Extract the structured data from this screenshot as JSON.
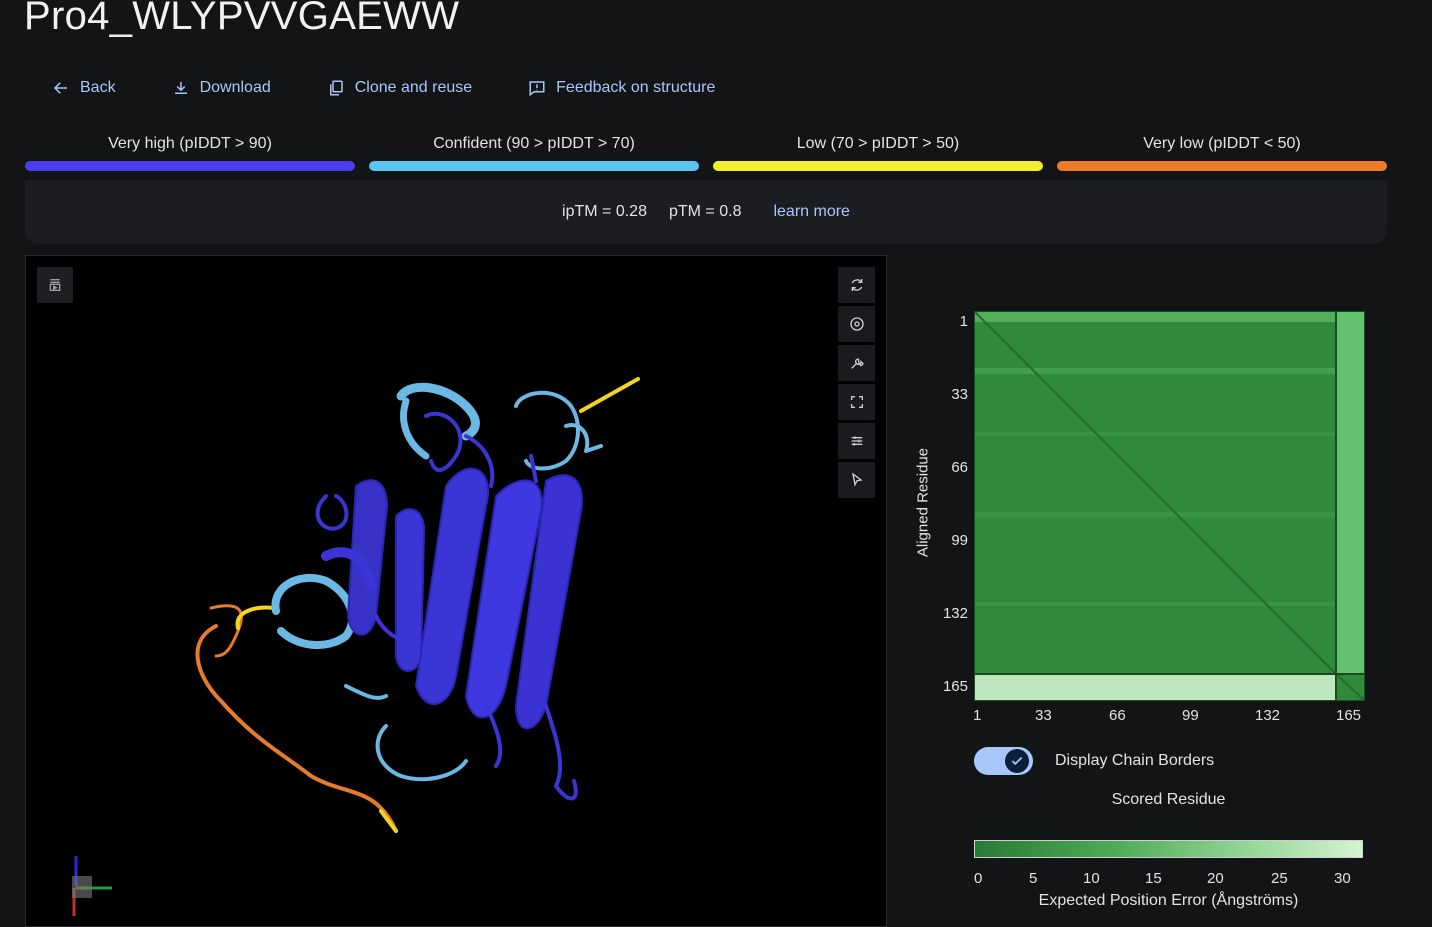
{
  "title": "Pro4_WLYPVVGAEWW",
  "toolbar": {
    "back": "Back",
    "download": "Download",
    "clone": "Clone and reuse",
    "feedback": "Feedback on structure"
  },
  "legend": [
    {
      "label": "Very high (pIDDT > 90)",
      "color": "#4b3ef0"
    },
    {
      "label": "Confident (90 > pIDDT > 70)",
      "color": "#5ac4f0"
    },
    {
      "label": "Low (70 > pIDDT > 50)",
      "color": "#f2f02a"
    },
    {
      "label": "Very low (pIDDT < 50)",
      "color": "#ec7c2a"
    }
  ],
  "metrics": {
    "iptm": "ipTM = 0.28",
    "ptm": "pTM = 0.8",
    "learn_more": "learn more"
  },
  "viewer_tools": [
    "restore-icon",
    "refresh-icon",
    "camera-icon",
    "wrench-icon",
    "fullscreen-icon",
    "sliders-icon",
    "cursor-icon"
  ],
  "pae": {
    "y_label": "Aligned Residue",
    "x_label": "Scored Residue",
    "ticks": [
      "1",
      "33",
      "66",
      "99",
      "132",
      "165"
    ],
    "toggle_label": "Display Chain Borders",
    "toggle_on": true,
    "colorbar_ticks": [
      "0",
      "5",
      "10",
      "15",
      "20",
      "25",
      "30"
    ],
    "colorbar_title": "Expected Position Error (Ångströms)"
  }
}
